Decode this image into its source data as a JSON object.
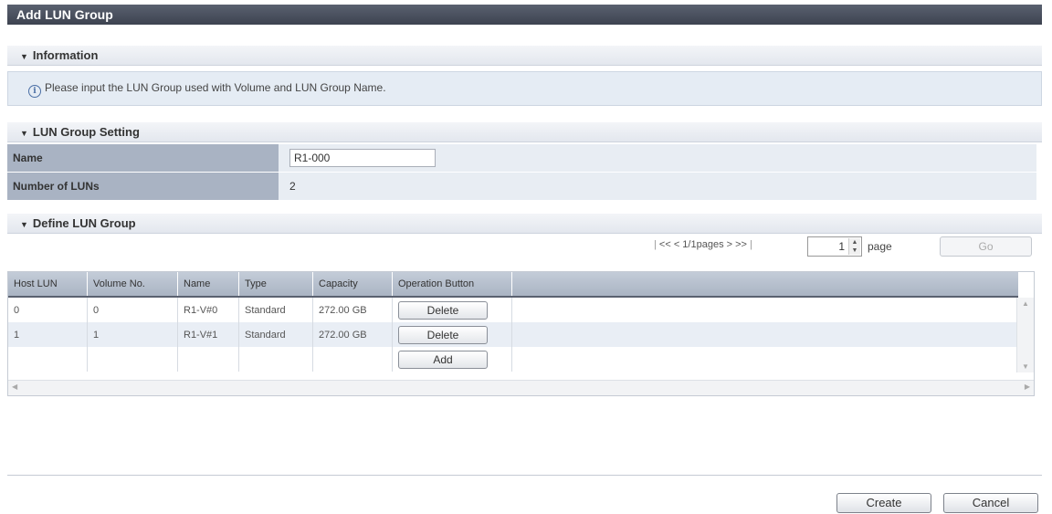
{
  "window": {
    "title": "Add LUN Group"
  },
  "information": {
    "header": "Information",
    "message": "Please input the LUN Group used with Volume and LUN Group Name."
  },
  "setting": {
    "header": "LUN Group Setting",
    "name_label": "Name",
    "name_value": "R1-000",
    "count_label": "Number of LUNs",
    "count_value": "2"
  },
  "define": {
    "header": "Define LUN Group",
    "pager_text": "<< < 1/1pages > >>",
    "page_value": "1",
    "page_label": "page",
    "go_label": "Go",
    "columns": [
      "Host LUN",
      "Volume No.",
      "Name",
      "Type",
      "Capacity",
      "Operation Button"
    ],
    "rows": [
      {
        "host_lun": "0",
        "volume_no": "0",
        "name": "R1-V#0",
        "type": "Standard",
        "capacity": "272.00 GB",
        "action": "Delete"
      },
      {
        "host_lun": "1",
        "volume_no": "1",
        "name": "R1-V#1",
        "type": "Standard",
        "capacity": "272.00 GB",
        "action": "Delete"
      }
    ],
    "add_label": "Add"
  },
  "footer": {
    "create_label": "Create",
    "cancel_label": "Cancel"
  }
}
